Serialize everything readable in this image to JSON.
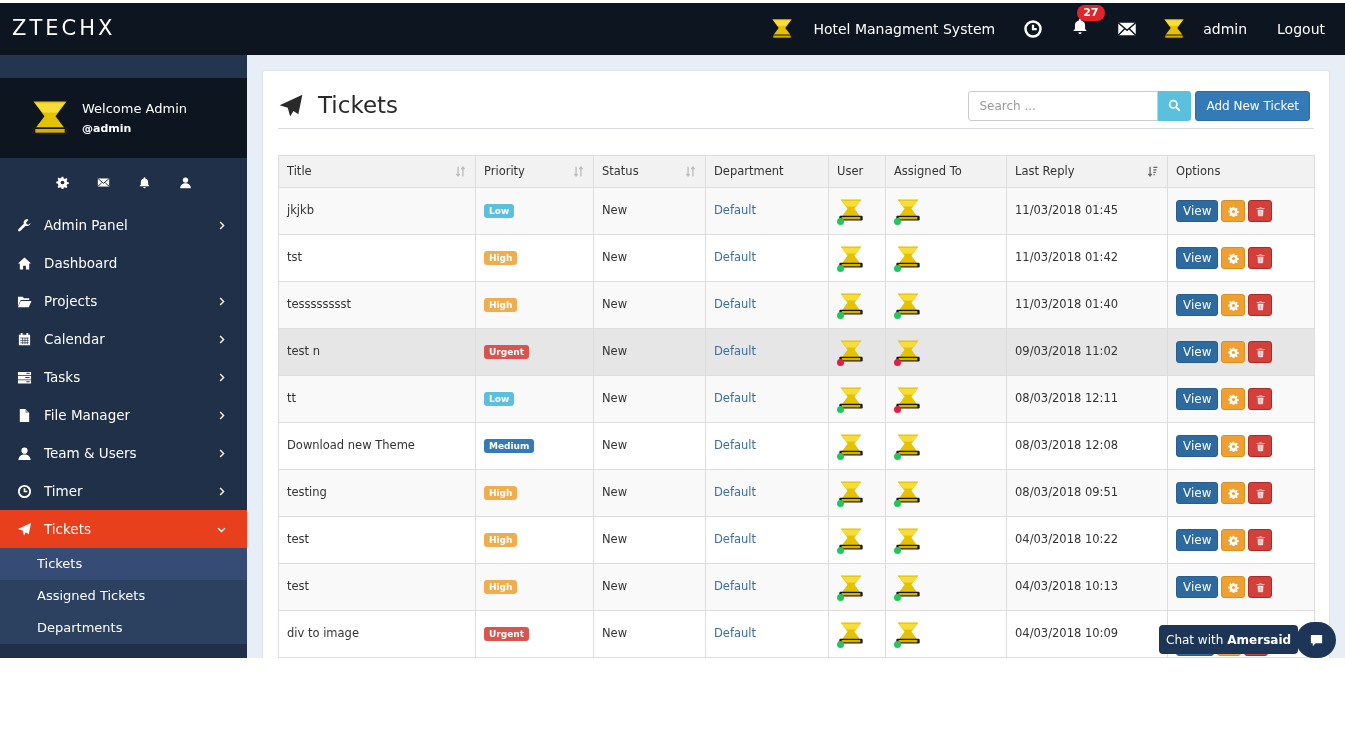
{
  "topbar": {
    "brand": "ZTECHX",
    "system_name": "Hotel Managment System",
    "notification_count": "27",
    "username": "admin",
    "logout": "Logout"
  },
  "sidebar": {
    "welcome": "Welcome Admin",
    "handle": "@admin",
    "items": [
      {
        "label": "Admin Panel",
        "has_children": true,
        "expanded": false,
        "selected": false
      },
      {
        "label": "Dashboard",
        "has_children": false,
        "selected": false
      },
      {
        "label": "Projects",
        "has_children": true,
        "expanded": false,
        "selected": false
      },
      {
        "label": "Calendar",
        "has_children": true,
        "expanded": false,
        "selected": false
      },
      {
        "label": "Tasks",
        "has_children": true,
        "expanded": false,
        "selected": false
      },
      {
        "label": "File Manager",
        "has_children": true,
        "expanded": false,
        "selected": false
      },
      {
        "label": "Team & Users",
        "has_children": true,
        "expanded": false,
        "selected": false
      },
      {
        "label": "Timer",
        "has_children": true,
        "expanded": false,
        "selected": false
      },
      {
        "label": "Tickets",
        "has_children": true,
        "expanded": true,
        "selected": true,
        "children": [
          {
            "label": "Tickets",
            "selected": true
          },
          {
            "label": "Assigned Tickets",
            "selected": false
          },
          {
            "label": "Departments",
            "selected": false
          }
        ]
      }
    ]
  },
  "page": {
    "title": "Tickets",
    "search": {
      "placeholder": "Search ..."
    },
    "add_button": "Add New Ticket"
  },
  "table": {
    "columns": [
      {
        "label": "Title",
        "kind": "sortable"
      },
      {
        "label": "Priority",
        "kind": "sortable"
      },
      {
        "label": "Status",
        "kind": "sortable"
      },
      {
        "label": "Department",
        "kind": "plain"
      },
      {
        "label": "User",
        "kind": "plain"
      },
      {
        "label": "Assigned To",
        "kind": "plain"
      },
      {
        "label": "Last Reply",
        "kind": "sorted"
      },
      {
        "label": "Options",
        "kind": "plain"
      }
    ],
    "rows": [
      {
        "title": "jkjkb",
        "priority": "Low",
        "color": "#5bc0de",
        "status": "New",
        "department": "Default",
        "user_online": true,
        "assigned_online": true,
        "last_reply": "11/03/2018 01:45",
        "hovered": false,
        "actions": [
          "View"
        ]
      },
      {
        "title": "tst",
        "priority": "High",
        "color": "#f0ad4e",
        "status": "New",
        "department": "Default",
        "user_online": true,
        "assigned_online": true,
        "last_reply": "11/03/2018 01:42",
        "hovered": false,
        "actions": [
          "View"
        ]
      },
      {
        "title": "tesssssssst",
        "priority": "High",
        "color": "#f0ad4e",
        "status": "New",
        "department": "Default",
        "user_online": true,
        "assigned_online": true,
        "last_reply": "11/03/2018 01:40",
        "hovered": false,
        "actions": [
          "View"
        ]
      },
      {
        "title": "test n",
        "priority": "Urgent",
        "color": "#d9534f",
        "status": "New",
        "department": "Default",
        "user_online": false,
        "assigned_online": false,
        "last_reply": "09/03/2018 11:02",
        "hovered": true,
        "actions": [
          "View"
        ]
      },
      {
        "title": "tt",
        "priority": "Low",
        "color": "#5bc0de",
        "status": "New",
        "department": "Default",
        "user_online": true,
        "assigned_online": false,
        "last_reply": "08/03/2018 12:11",
        "hovered": false,
        "actions": [
          "View"
        ]
      },
      {
        "title": "Download new Theme",
        "priority": "Medium",
        "color": "#337ab7",
        "status": "New",
        "department": "Default",
        "user_online": true,
        "assigned_online": true,
        "last_reply": "08/03/2018 12:08",
        "hovered": false,
        "actions": [
          "View"
        ]
      },
      {
        "title": "testing",
        "priority": "High",
        "color": "#f0ad4e",
        "status": "New",
        "department": "Default",
        "user_online": true,
        "assigned_online": true,
        "last_reply": "08/03/2018 09:51",
        "hovered": false,
        "actions": [
          "View"
        ]
      },
      {
        "title": "test",
        "priority": "High",
        "color": "#f0ad4e",
        "status": "New",
        "department": "Default",
        "user_online": true,
        "assigned_online": true,
        "last_reply": "04/03/2018 10:22",
        "hovered": false,
        "actions": [
          "View"
        ]
      },
      {
        "title": "test",
        "priority": "High",
        "color": "#f0ad4e",
        "status": "New",
        "department": "Default",
        "user_online": true,
        "assigned_online": true,
        "last_reply": "04/03/2018 10:13",
        "hovered": false,
        "actions": [
          "View"
        ]
      },
      {
        "title": "div to image",
        "priority": "Urgent",
        "color": "#d9534f",
        "status": "New",
        "department": "Default",
        "user_online": true,
        "assigned_online": true,
        "last_reply": "04/03/2018 10:09",
        "hovered": false,
        "actions": []
      }
    ]
  },
  "chat": {
    "label": "Chat with **Amersaid**"
  }
}
